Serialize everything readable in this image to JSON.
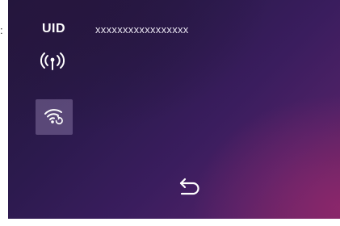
{
  "edge": {
    "colon": ":"
  },
  "header": {
    "uid_label": "UID",
    "uid_value": "xxxxxxxxxxxxxxxxx"
  },
  "icons": {
    "signal": "broadcast-signal-icon",
    "wifi_config": "wifi-settings-icon",
    "back": "return-arrow-icon"
  },
  "colors": {
    "background_dark": "#22163a",
    "background_accent": "#6a2462",
    "button_bg": "#82709e",
    "foreground": "#ffffff"
  }
}
